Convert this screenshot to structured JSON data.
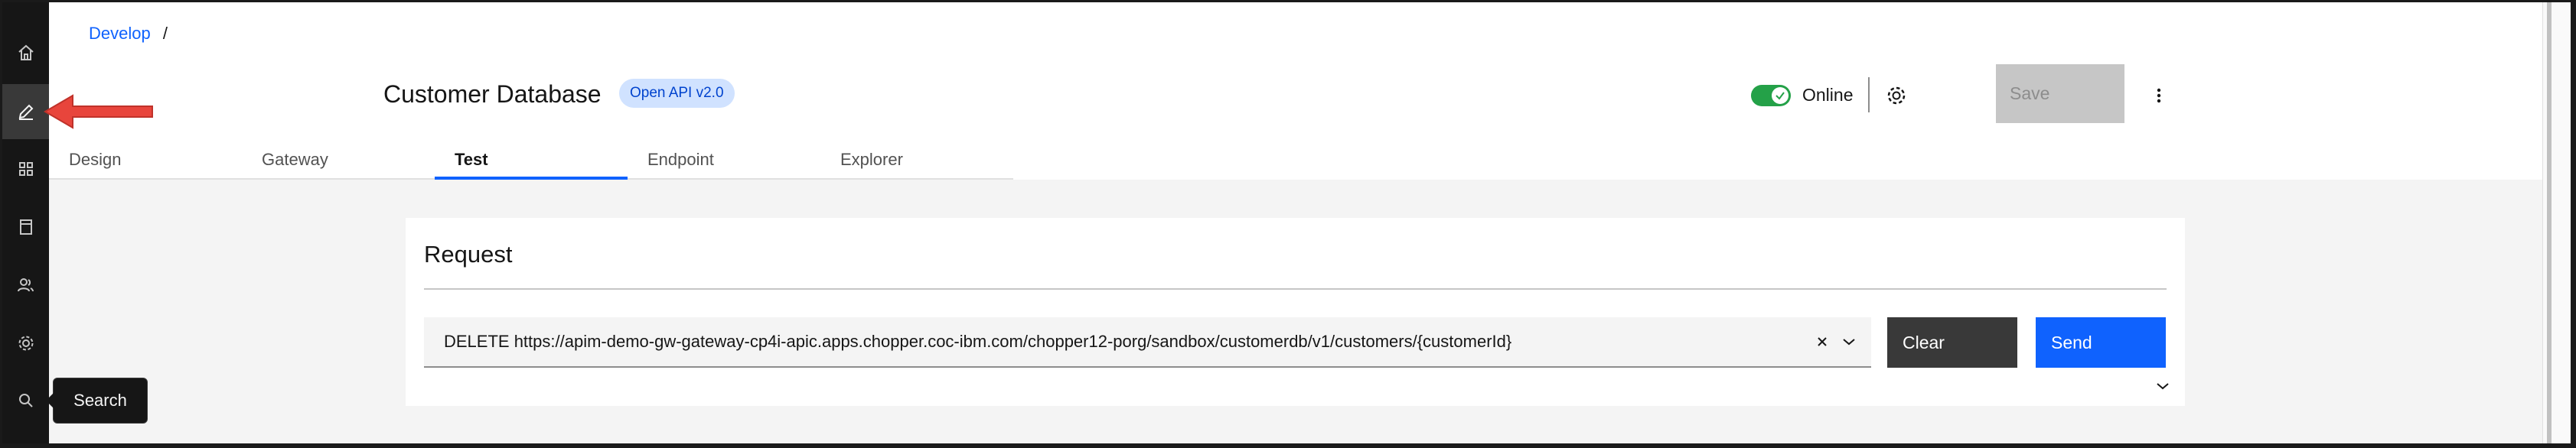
{
  "breadcrumb": {
    "link": "Develop",
    "separator": "/"
  },
  "api": {
    "title": "Customer Database",
    "version_badge": "Open API v2.0"
  },
  "status": {
    "online_label": "Online",
    "online": true
  },
  "toolbar": {
    "save_label": "Save"
  },
  "tabs": [
    {
      "label": "Design",
      "active": false
    },
    {
      "label": "Gateway",
      "active": false
    },
    {
      "label": "Test",
      "active": true
    },
    {
      "label": "Endpoint",
      "active": false
    },
    {
      "label": "Explorer",
      "active": false
    }
  ],
  "rail": {
    "items": [
      "home-icon",
      "edit-icon",
      "apps-icon",
      "catalog-icon",
      "users-icon",
      "settings-icon",
      "search-icon"
    ],
    "active": "edit-icon",
    "tooltip": "Search"
  },
  "request": {
    "title": "Request",
    "url": "DELETE https://apim-demo-gw-gateway-cp4i-apic.apps.chopper.coc-ibm.com/chopper12-porg/sandbox/customerdb/v1/customers/{customerId}",
    "clear_label": "Clear",
    "send_label": "Send"
  },
  "colors": {
    "accent": "#0f62fe",
    "toggle_on": "#24a148",
    "annotation_arrow": "#e8453c"
  }
}
